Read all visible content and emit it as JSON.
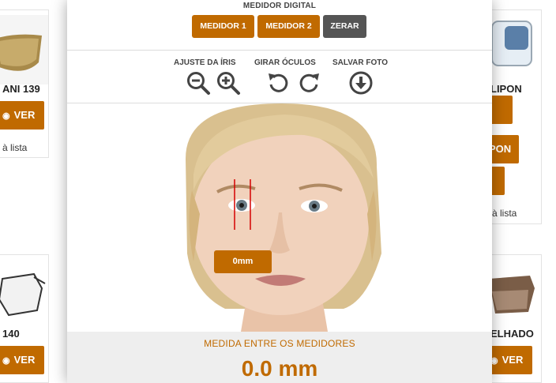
{
  "products": {
    "left_top": {
      "name": "ANI 139",
      "ver_label": "VER",
      "list_label": "à lista"
    },
    "left_bottom": {
      "name": "140",
      "ver_label": "VER"
    },
    "right_top": {
      "name": "LIPON",
      "btn2_label": "PON",
      "list_label": "à lista"
    },
    "right_bottom": {
      "name": "ELHADO",
      "ver_label": "VER"
    }
  },
  "modal": {
    "header": "MEDIDOR DIGITAL",
    "buttons": {
      "medidor1": "MEDIDOR 1",
      "medidor2": "MEDIDOR 2",
      "zerar": "ZERAR"
    },
    "tools": {
      "iris_label": "AJUSTE DA ÍRIS",
      "rotate_label": "GIRAR ÓCULOS",
      "save_label": "SALVAR FOTO"
    },
    "measure_chip": "0mm",
    "footer_label": "MEDIDA ENTRE OS MEDIDORES",
    "footer_value": "0.0 mm"
  },
  "colors": {
    "accent": "#c06a00",
    "neutral_button": "#555555",
    "marker": "#d40000"
  },
  "icons": [
    "zoom-out-icon",
    "zoom-in-icon",
    "rotate-left-icon",
    "rotate-right-icon",
    "download-icon",
    "eye-icon"
  ]
}
